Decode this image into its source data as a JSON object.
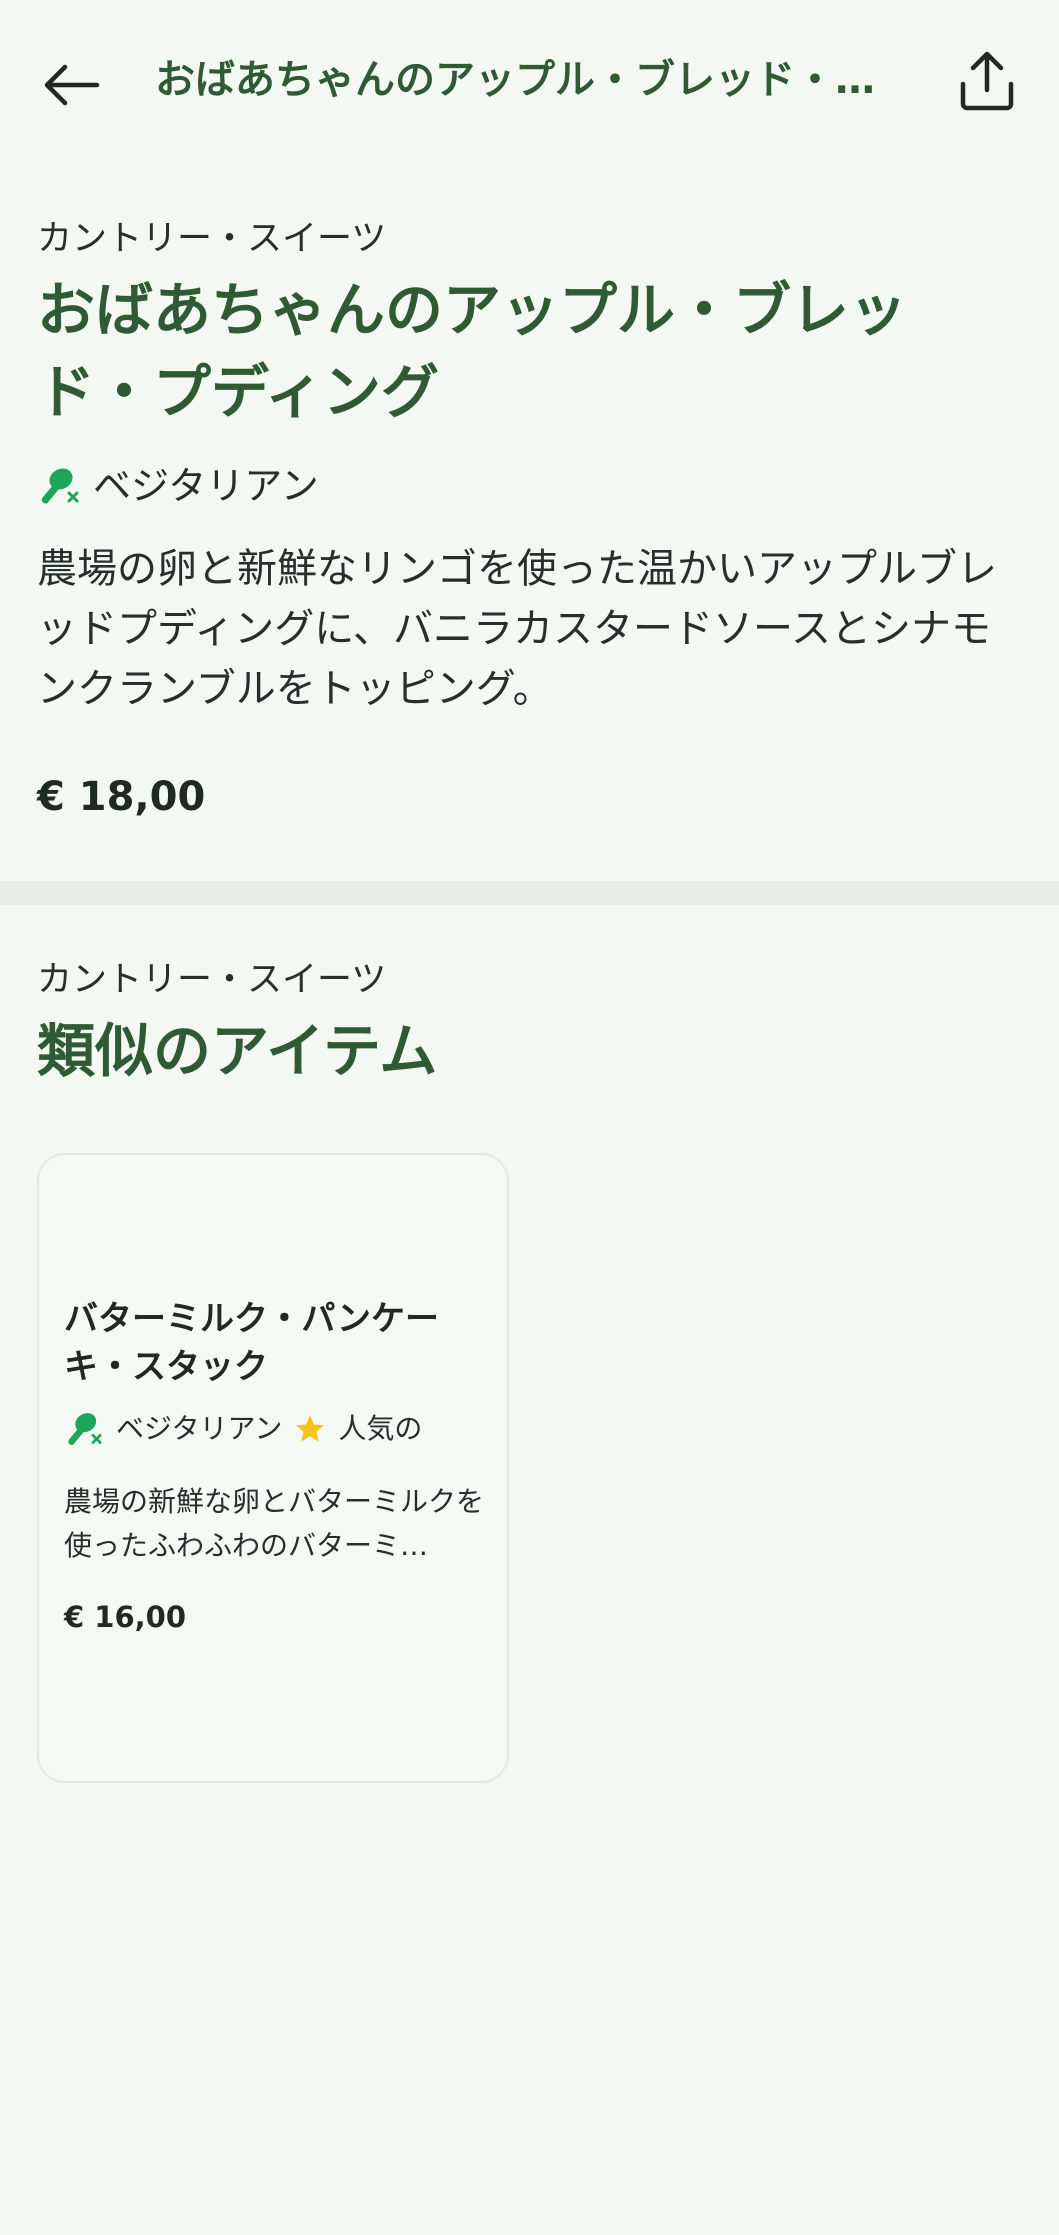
{
  "header": {
    "title": "おばあちゃんのアップル・ブレッド・プディング",
    "back_icon": "arrow-left-icon",
    "share_icon": "share-icon"
  },
  "item": {
    "category": "カントリー・スイーツ",
    "title": "おばあちゃんのアップル・ブレッド・プディング",
    "tag": "ベジタリアン",
    "description": "農場の卵と新鮮なリンゴを使った温かいアップルブレッドプディングに、バニラカスタードソースとシナモンクランブルをトッピング。",
    "price": "€ 18,00"
  },
  "similar": {
    "category": "カントリー・スイーツ",
    "title": "類似のアイテム",
    "items": [
      {
        "title": "バターミルク・パンケーキ・スタック",
        "tag_vegetarian": "ベジタリアン",
        "tag_popular": "人気の",
        "description": "農場の新鮮な卵とバターミルクを使ったふわふわのバターミ…",
        "price": "€ 16,00"
      }
    ]
  },
  "colors": {
    "background": "#f4f8f3",
    "accent_green": "#2f5a34",
    "veg_icon_green": "#1ea55a",
    "star_yellow": "#f5c220"
  }
}
